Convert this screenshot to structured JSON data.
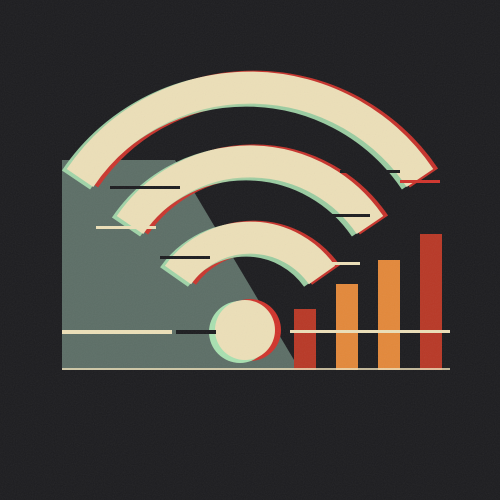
{
  "illustration": {
    "subject": "wifi-signal-glitch-icon",
    "colors": {
      "background": "#1c1c1f",
      "panel": "#5c6e66",
      "wifi": "#ecdfb8",
      "glitch_red": "#d0342c",
      "glitch_mint": "#a8e0b0",
      "bar_red": "#b83826",
      "bar_orange": "#e3883a"
    },
    "signal_bars": [
      {
        "name": "bar-1",
        "color": "#b83826",
        "level": 0.45
      },
      {
        "name": "bar-2",
        "color": "#e3883a",
        "level": 0.63
      },
      {
        "name": "bar-3",
        "color": "#e3883a",
        "level": 0.81
      },
      {
        "name": "bar-4",
        "color": "#b83826",
        "level": 1.0
      }
    ]
  }
}
